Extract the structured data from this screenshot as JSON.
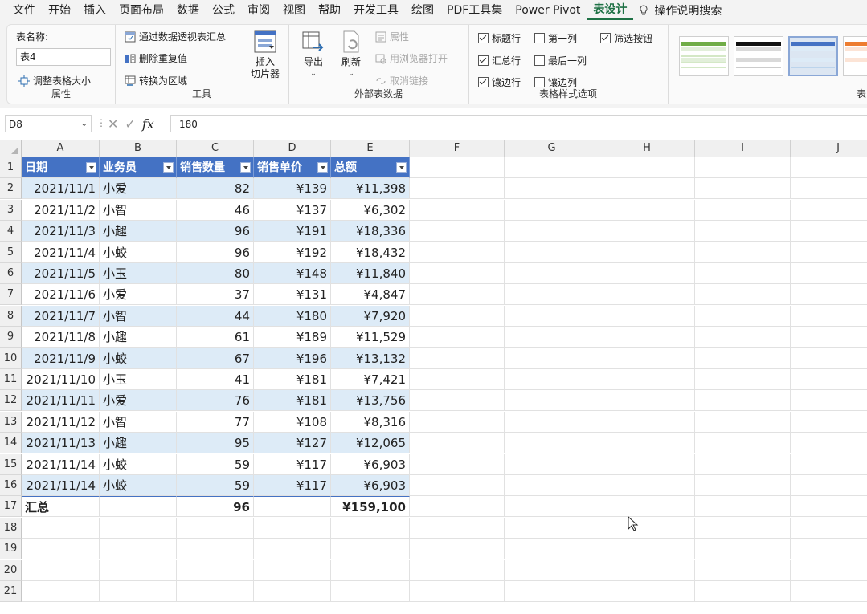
{
  "menu": {
    "items": [
      "文件",
      "开始",
      "插入",
      "页面布局",
      "数据",
      "公式",
      "审阅",
      "视图",
      "帮助",
      "开发工具",
      "绘图",
      "PDF工具集",
      "Power Pivot",
      "表设计"
    ],
    "active": "表设计",
    "search_label": "操作说明搜索"
  },
  "ribbon": {
    "properties": {
      "table_name_label": "表名称:",
      "table_name_value": "表4",
      "resize_label": "调整表格大小",
      "group_label": "属性"
    },
    "tools": {
      "pivot_label": "通过数据透视表汇总",
      "dedupe_label": "删除重复值",
      "convert_label": "转换为区域",
      "slicer_label_1": "插入",
      "slicer_label_2": "切片器",
      "group_label": "工具"
    },
    "external": {
      "export_label": "导出",
      "refresh_label": "刷新",
      "properties_label": "属性",
      "open_browser_label": "用浏览器打开",
      "unlink_label": "取消链接",
      "group_label": "外部表数据"
    },
    "style_options": {
      "header_row": "标题行",
      "total_row": "汇总行",
      "banded_rows": "镶边行",
      "first_column": "第一列",
      "last_column": "最后一列",
      "banded_columns": "镶边列",
      "filter_button": "筛选按钮",
      "group_label": "表格样式选项",
      "checked": {
        "header_row": true,
        "total_row": true,
        "banded_rows": true,
        "first_column": false,
        "last_column": false,
        "banded_columns": false,
        "filter_button": true
      }
    },
    "styles_group_label_partial": "表"
  },
  "formula_bar": {
    "name_box": "D8",
    "fx": "fx",
    "formula": "180"
  },
  "sheet": {
    "columns": [
      "A",
      "B",
      "C",
      "D",
      "E",
      "F",
      "G",
      "H",
      "I",
      "J"
    ],
    "row_numbers": [
      "1",
      "2",
      "3",
      "4",
      "5",
      "6",
      "7",
      "8",
      "9",
      "10",
      "11",
      "12",
      "13",
      "14",
      "15",
      "16",
      "17",
      "18",
      "19",
      "20",
      "21"
    ],
    "headers": [
      "日期",
      "业务员",
      "销售数量",
      "销售单价",
      "总额"
    ],
    "rows": [
      [
        "2021/11/1",
        "小爱",
        "82",
        "¥139",
        "¥11,398"
      ],
      [
        "2021/11/2",
        "小智",
        "46",
        "¥137",
        "¥6,302"
      ],
      [
        "2021/11/3",
        "小趣",
        "96",
        "¥191",
        "¥18,336"
      ],
      [
        "2021/11/4",
        "小蛟",
        "96",
        "¥192",
        "¥18,432"
      ],
      [
        "2021/11/5",
        "小玉",
        "80",
        "¥148",
        "¥11,840"
      ],
      [
        "2021/11/6",
        "小爱",
        "37",
        "¥131",
        "¥4,847"
      ],
      [
        "2021/11/7",
        "小智",
        "44",
        "¥180",
        "¥7,920"
      ],
      [
        "2021/11/8",
        "小趣",
        "61",
        "¥189",
        "¥11,529"
      ],
      [
        "2021/11/9",
        "小蛟",
        "67",
        "¥196",
        "¥13,132"
      ],
      [
        "2021/11/10",
        "小玉",
        "41",
        "¥181",
        "¥7,421"
      ],
      [
        "2021/11/11",
        "小爱",
        "76",
        "¥181",
        "¥13,756"
      ],
      [
        "2021/11/12",
        "小智",
        "77",
        "¥108",
        "¥8,316"
      ],
      [
        "2021/11/13",
        "小趣",
        "95",
        "¥127",
        "¥12,065"
      ],
      [
        "2021/11/14",
        "小蛟",
        "59",
        "¥117",
        "¥6,903"
      ],
      [
        "2021/11/14",
        "小蛟",
        "59",
        "¥117",
        "¥6,903"
      ]
    ],
    "total_row": [
      "汇总",
      "",
      "96",
      "",
      "¥159,100"
    ],
    "colors": {
      "header": "#4472c4",
      "band": "#ddebf7",
      "accent": "#1e7145"
    }
  }
}
